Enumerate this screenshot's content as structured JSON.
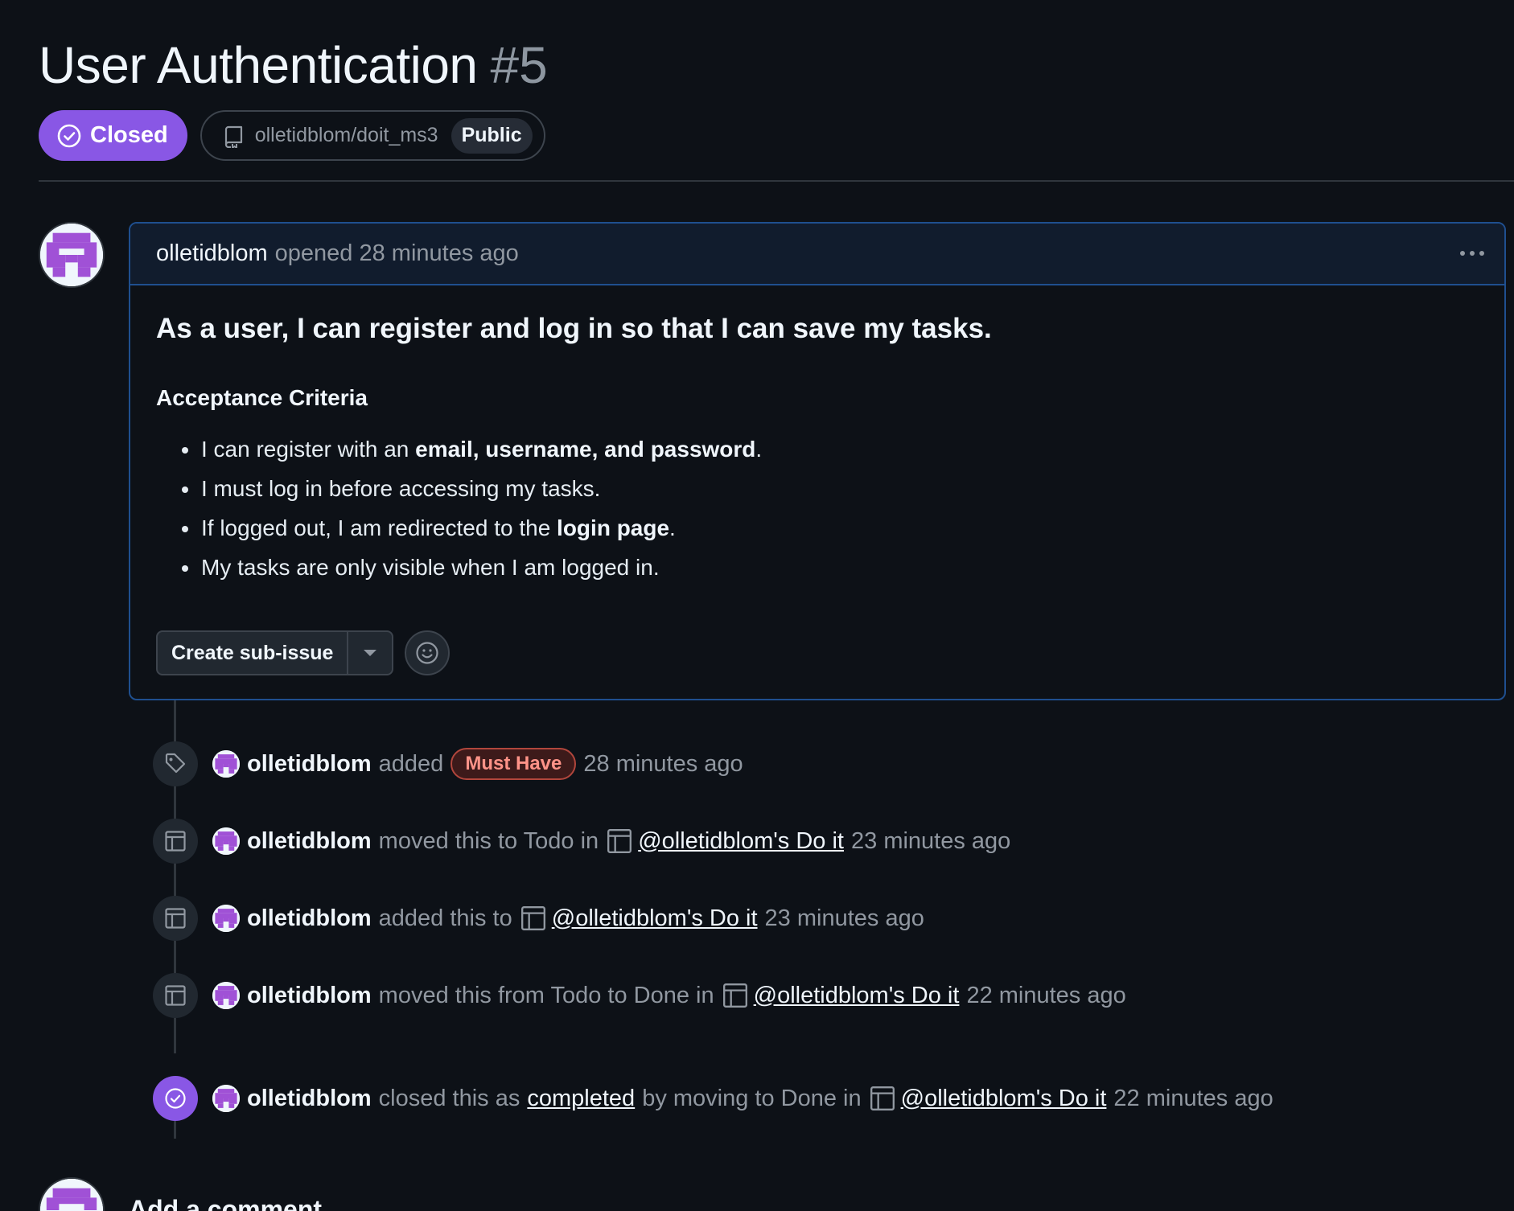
{
  "issue": {
    "title": "User Authentication",
    "number": "#5",
    "state": "Closed",
    "repo": "olletidblom/doit_ms3",
    "visibility": "Public"
  },
  "comment": {
    "author": "olletidblom",
    "action": "opened 28 minutes ago",
    "heading": "As a user, I can register and log in so that I can save my tasks.",
    "criteria_heading": "Acceptance Criteria",
    "criteria": [
      {
        "pre": "I can register with an ",
        "bold": "email, username, and password",
        "post": "."
      },
      {
        "pre": "I must log in before accessing my tasks.",
        "bold": "",
        "post": ""
      },
      {
        "pre": "If logged out, I am redirected to the ",
        "bold": "login page",
        "post": "."
      },
      {
        "pre": "My tasks are only visible when I am logged in.",
        "bold": "",
        "post": ""
      }
    ],
    "create_sub_issue_label": "Create sub-issue"
  },
  "timeline": [
    {
      "icon": "tag-icon",
      "author": "olletidblom",
      "text1": "added",
      "label": "Must Have",
      "text2": "",
      "link": "",
      "time": "28 minutes ago"
    },
    {
      "icon": "project-icon",
      "author": "olletidblom",
      "text1": "moved this to Todo in",
      "label": "",
      "text2": "",
      "link": "@olletidblom's Do it",
      "time": "23 minutes ago"
    },
    {
      "icon": "project-icon",
      "author": "olletidblom",
      "text1": "added this to",
      "label": "",
      "text2": "",
      "link": "@olletidblom's Do it",
      "time": "23 minutes ago"
    },
    {
      "icon": "project-icon",
      "author": "olletidblom",
      "text1": "moved this from Todo to Done in",
      "label": "",
      "text2": "",
      "link": "@olletidblom's Do it",
      "time": "22 minutes ago"
    },
    {
      "icon": "check-circle-icon",
      "author": "olletidblom",
      "text1": "closed this as",
      "completed": "completed",
      "text2": "by moving to Done in",
      "link": "@olletidblom's Do it",
      "time": "22 minutes ago"
    }
  ],
  "footer": {
    "add_comment": "Add a comment"
  },
  "colors": {
    "closed_purple": "#8957e5",
    "label_red": "#ff9388",
    "background": "#0d1117"
  }
}
